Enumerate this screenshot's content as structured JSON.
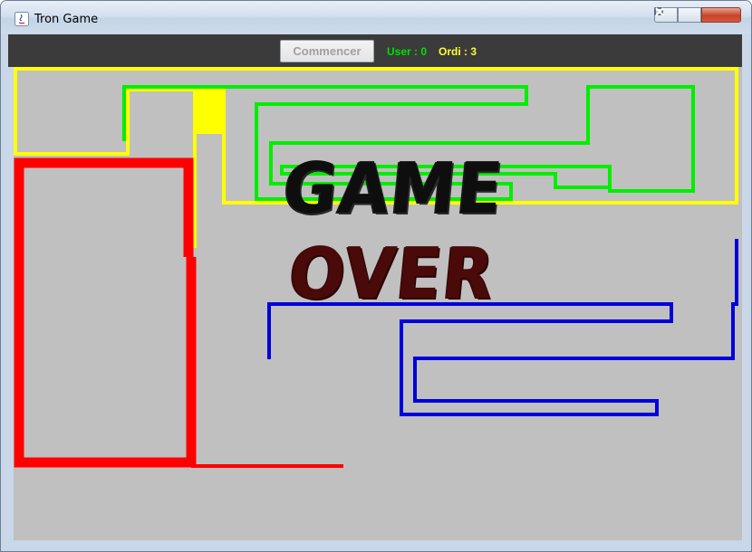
{
  "window": {
    "title": "Tron Game"
  },
  "toolbar": {
    "start_label": "Commencer",
    "user_score": "User : 0",
    "ordi_score": "Ordi : 3"
  },
  "overlay": {
    "line1": "GAME",
    "line2": "OVER"
  },
  "colors": {
    "arena": "#c0c0c0",
    "toolbar": "#3b3b3b",
    "user_score": "#00e000",
    "ordi_score": "#ffff33",
    "player_red": "#ff0000",
    "player_yellow": "#ffff00",
    "player_green": "#00ee00",
    "player_blue": "#0000dd"
  }
}
